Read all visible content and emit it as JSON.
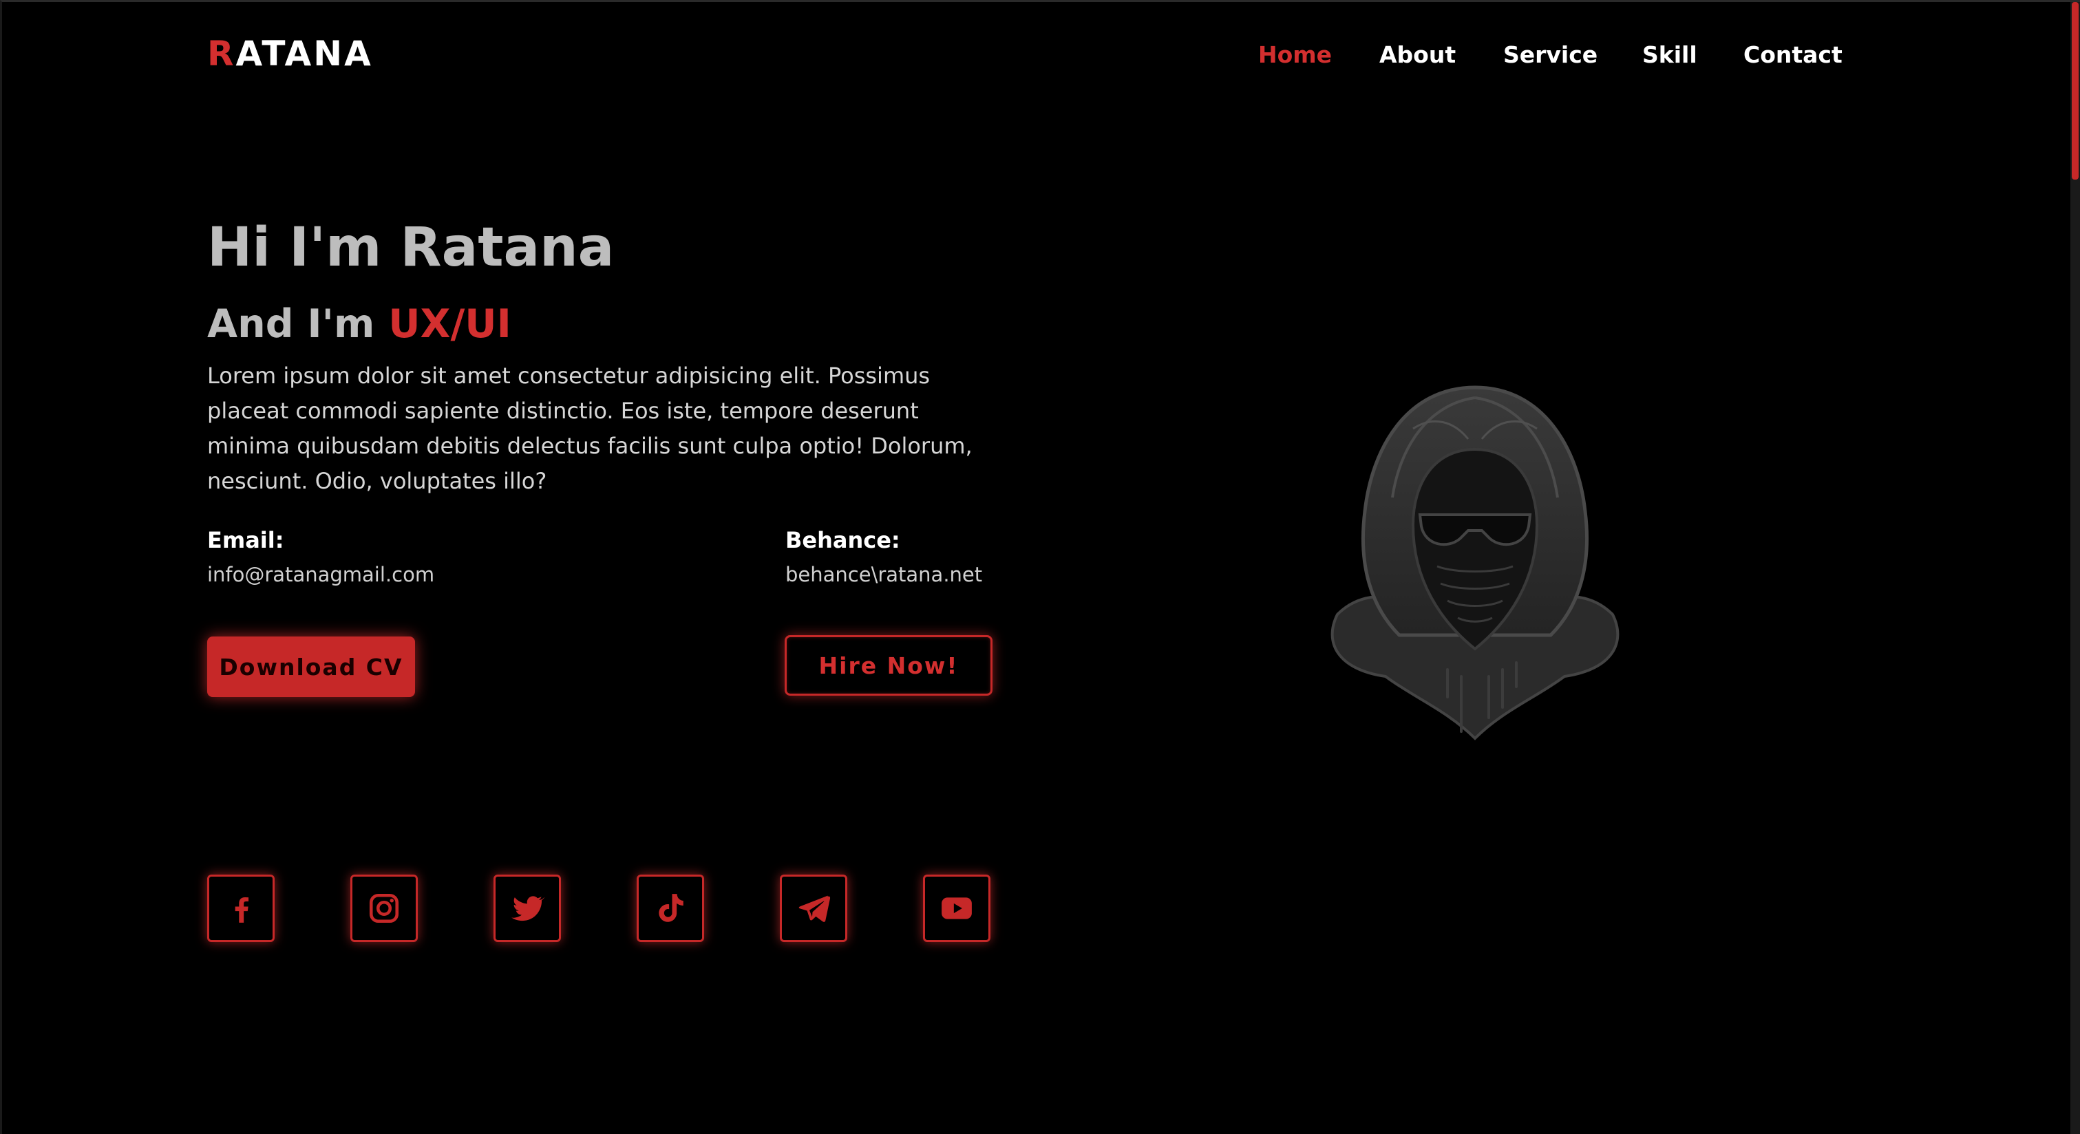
{
  "logo": {
    "first_letter": "R",
    "rest": "ATANA"
  },
  "nav": {
    "items": [
      {
        "label": "Home",
        "active": true
      },
      {
        "label": "About",
        "active": false
      },
      {
        "label": "Service",
        "active": false
      },
      {
        "label": "Skill",
        "active": false
      },
      {
        "label": "Contact",
        "active": false
      }
    ]
  },
  "hero": {
    "title": "Hi I'm Ratana",
    "subtitle_prefix": "And I'm ",
    "subtitle_role": "UX/UI",
    "description": "Lorem ipsum dolor sit amet consectetur adipisicing elit. Possimus placeat commodi sapiente distinctio. Eos iste, tempore deserunt minima quibusdam debitis delectus facilis sunt culpa optio! Dolorum, nesciunt. Odio, voluptates illo?",
    "email_label": "Email:",
    "email_value": "info@ratanagmail.com",
    "behance_label": "Behance:",
    "behance_value": "behance\\ratana.net",
    "download_label": "Download CV",
    "hire_label": "Hire Now!"
  },
  "social": [
    "facebook-icon",
    "instagram-icon",
    "twitter-icon",
    "tiktok-icon",
    "telegram-icon",
    "youtube-icon"
  ],
  "colors": {
    "accent": "#d32f2f",
    "background": "#000000",
    "heading": "#bdbdbd",
    "text": "#d6d6d6"
  }
}
